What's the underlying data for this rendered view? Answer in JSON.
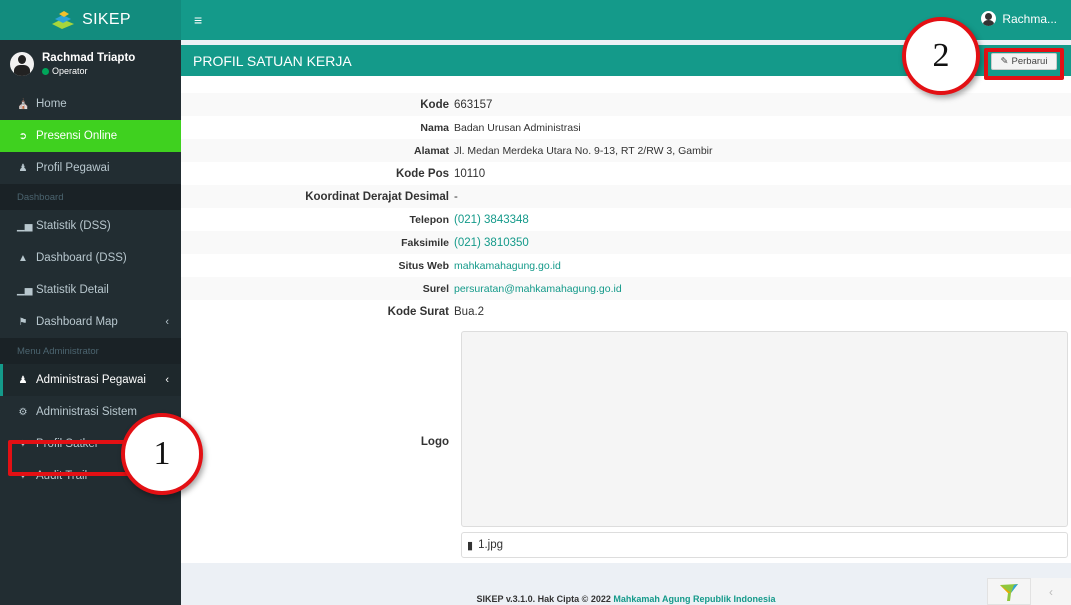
{
  "app": {
    "name": "SIKEP"
  },
  "topbar": {
    "user_short": "Rachma..."
  },
  "user": {
    "name": "Rachmad Triapto",
    "role": "Operator"
  },
  "sidebar": {
    "items_top": [
      {
        "label": "Home",
        "icon": "home-icon"
      },
      {
        "label": "Presensi Online",
        "icon": "sign-in-icon"
      },
      {
        "label": "Profil Pegawai",
        "icon": "user-icon"
      }
    ],
    "header_dashboard": "Dashboard",
    "items_dashboard": [
      {
        "label": "Statistik (DSS)",
        "icon": "bar-chart-icon"
      },
      {
        "label": "Dashboard (DSS)",
        "icon": "area-chart-icon"
      },
      {
        "label": "Statistik Detail",
        "icon": "bar-chart-icon"
      },
      {
        "label": "Dashboard Map",
        "icon": "flag-icon"
      }
    ],
    "header_admin": "Menu Administrator",
    "items_admin": [
      {
        "label": "Administrasi Pegawai",
        "icon": "user-icon"
      },
      {
        "label": "Administrasi Sistem",
        "icon": "cog-icon"
      },
      {
        "label": "Profil Satker",
        "icon": "crosshair-icon"
      },
      {
        "label": "Audit Trail",
        "icon": "crosshair-icon"
      }
    ]
  },
  "page": {
    "title": "PROFIL SATUAN KERJA",
    "update_button": "Perbarui"
  },
  "profile": {
    "kode": {
      "label": "Kode",
      "value": "663157"
    },
    "nama": {
      "label": "Nama",
      "value": "Badan Urusan Administrasi"
    },
    "alamat": {
      "label": "Alamat",
      "value": "Jl. Medan Merdeka Utara No. 9-13, RT 2/RW 3, Gambir"
    },
    "kode_pos": {
      "label": "Kode Pos",
      "value": "10110"
    },
    "koordinat": {
      "label": "Koordinat Derajat Desimal",
      "value": "-"
    },
    "telepon": {
      "label": "Telepon",
      "value": "(021) 3843348"
    },
    "faksimile": {
      "label": "Faksimile",
      "value": "(021) 3810350"
    },
    "situs_web": {
      "label": "Situs Web",
      "value": "mahkamahagung.go.id"
    },
    "surel": {
      "label": "Surel",
      "value": "persuratan@mahkamahagung.go.id"
    },
    "kode_surat": {
      "label": "Kode Surat",
      "value": "Bua.2"
    },
    "logo": {
      "label": "Logo",
      "file": "1.jpg"
    }
  },
  "footer": {
    "text": "SIKEP v.3.1.0. Hak Cipta © 2022 ",
    "link": "Mahkamah Agung Republik Indonesia"
  },
  "annotations": {
    "callout_1": "1",
    "callout_2": "2"
  },
  "colors": {
    "teal": "#149a8a",
    "green_active": "#3fd11f",
    "sidebar_bg": "#222d32",
    "highlight_red": "#e31014"
  }
}
